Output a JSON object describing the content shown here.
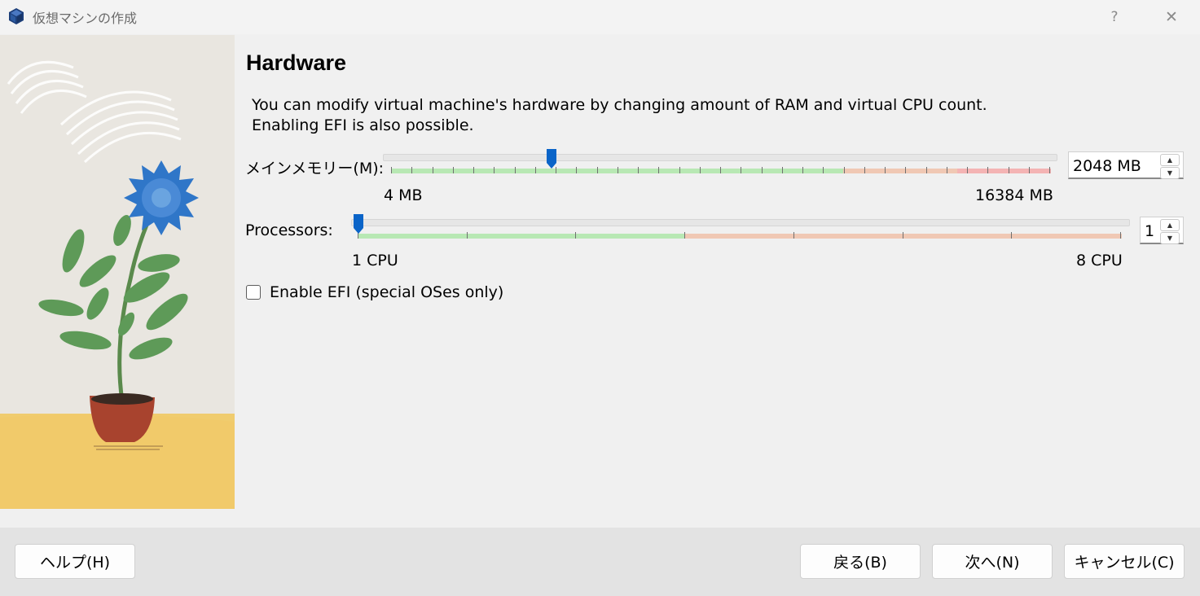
{
  "window": {
    "title": "仮想マシンの作成",
    "help_glyph": "?",
    "close_glyph": "✕"
  },
  "page": {
    "heading": "Hardware",
    "description": "You can modify virtual machine's hardware by changing amount of RAM and virtual CPU count.\nEnabling EFI is also possible."
  },
  "memory": {
    "label": "メインメモリー(M):",
    "value": "2048 MB",
    "min_label": "4 MB",
    "max_label": "16384 MB",
    "min": 4,
    "max": 16384,
    "current": 2048
  },
  "processors": {
    "label": "Processors:",
    "value": "1",
    "min_label": "1 CPU",
    "max_label": "8 CPU",
    "min": 1,
    "max": 8,
    "current": 1
  },
  "efi": {
    "label": "Enable EFI (special OSes only)",
    "checked": false
  },
  "footer": {
    "help": "ヘルプ(H)",
    "back": "戻る(B)",
    "next": "次へ(N)",
    "cancel": "キャンセル(C)"
  },
  "colors": {
    "accent": "#0a64c8",
    "scale_green": "#b8e8b4",
    "scale_orange": "#f0c8b4",
    "scale_red": "#f4b4b4"
  }
}
